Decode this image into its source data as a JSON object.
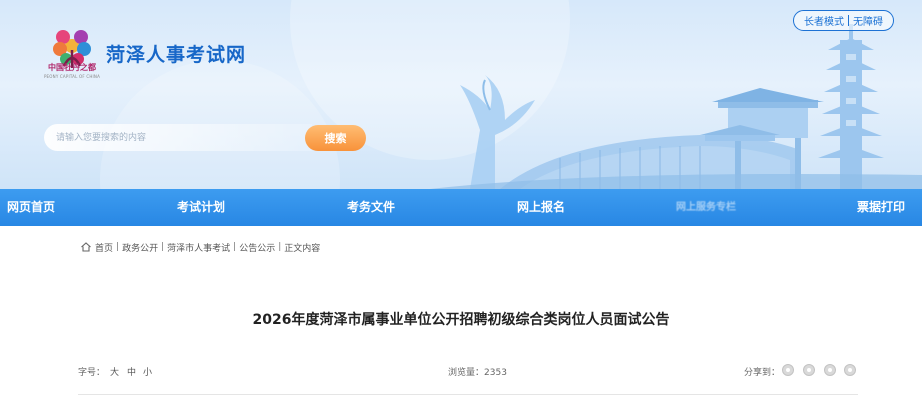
{
  "header": {
    "site_title": "菏泽人事考试网",
    "logo_caption": "中国牡丹之都",
    "logo_sub": "PEONY CAPITAL OF CHINA",
    "accessibility": {
      "elder_mode": "长者模式",
      "barrier_free": "无障碍"
    },
    "search": {
      "placeholder": "请输入您要搜索的内容",
      "button": "搜索"
    }
  },
  "nav": {
    "items": [
      {
        "label": "网页首页"
      },
      {
        "label": "考试计划"
      },
      {
        "label": "考务文件"
      },
      {
        "label": "网上报名"
      },
      {
        "label": "网上服务专栏"
      },
      {
        "label": "票据打印"
      }
    ]
  },
  "breadcrumb": {
    "items": [
      "首页",
      "政务公开",
      "菏泽市人事考试",
      "公告公示",
      "正文内容"
    ],
    "separator": "|"
  },
  "article": {
    "title": "2026年度菏泽市属事业单位公开招聘初级综合类岗位人员面试公告",
    "font_size_label": "字号：",
    "font_sizes": [
      "大",
      "中",
      "小"
    ],
    "views_label": "浏览量：",
    "views": "2353",
    "share_label": "分享到："
  },
  "colors": {
    "brand_blue": "#1767c8",
    "nav_blue": "#2887e4",
    "search_orange": "#f8923a"
  },
  "icons": [
    "home-icon",
    "share-icon"
  ]
}
